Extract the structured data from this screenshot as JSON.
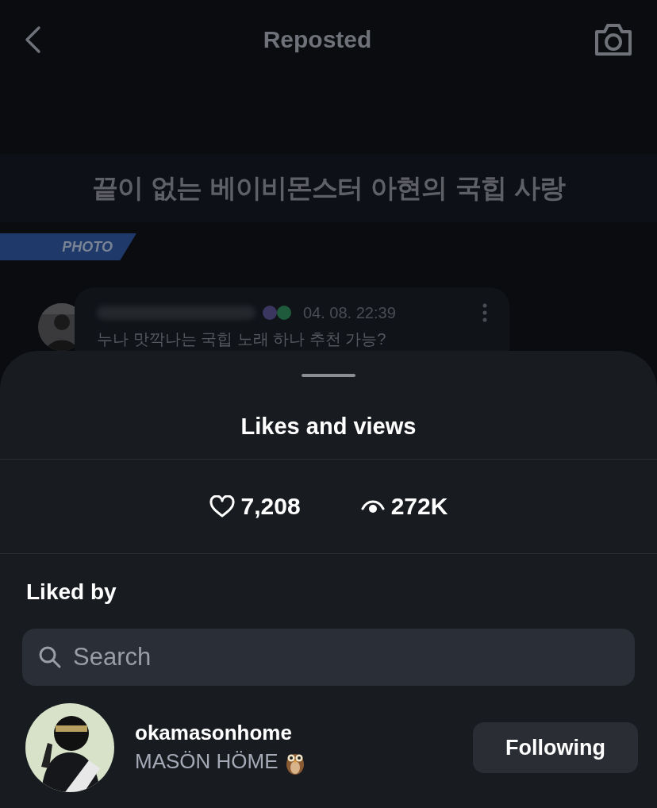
{
  "header": {
    "title": "Reposted"
  },
  "background_post": {
    "headline": "끝이 없는 베이비몬스터 아현의 국힙 사랑",
    "tag": "PHOTO",
    "comment": {
      "time": "04. 08. 22:39",
      "text": "누나 맛깍나는 국힙 노래 하나 추천 가능?"
    }
  },
  "sheet": {
    "title": "Likes and views",
    "likes": "7,208",
    "views": "272K",
    "section": "Liked by",
    "search": {
      "placeholder": "Search"
    },
    "users": [
      {
        "username": "okamasonhome",
        "display_name": "MASÖN HÖME",
        "button": "Following"
      }
    ]
  }
}
